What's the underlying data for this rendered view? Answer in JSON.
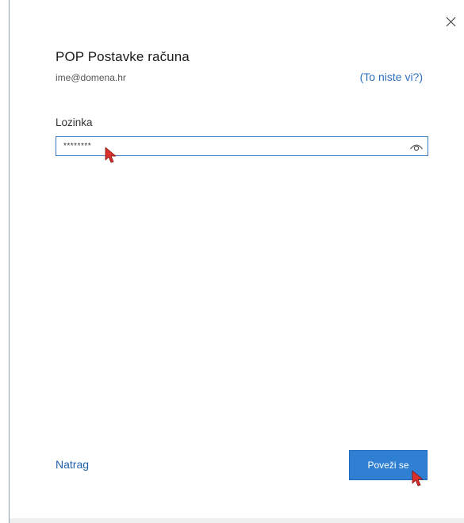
{
  "dialog": {
    "title": "POP Postavke računa",
    "email": "ime@domena.hr",
    "not_you_link": "(To niste vi?)",
    "close_icon": "close-icon"
  },
  "password": {
    "label": "Lozinka",
    "value": "********",
    "reveal_icon": "eye-icon"
  },
  "footer": {
    "back_label": "Natrag",
    "connect_label": "Poveži se"
  },
  "colors": {
    "accent": "#2f7fd3",
    "link": "#2c6fbd",
    "cursor": "#d9302b"
  }
}
